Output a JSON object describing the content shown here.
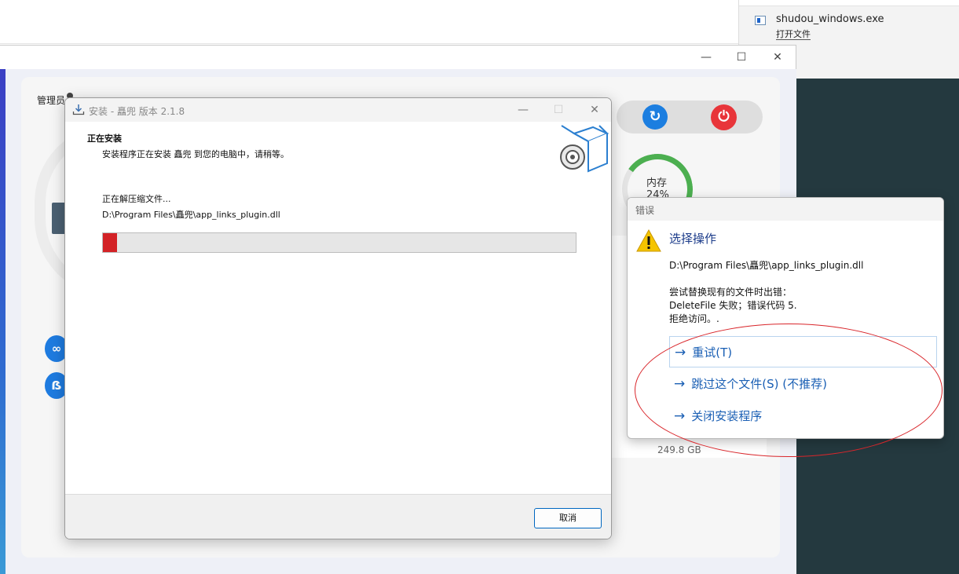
{
  "download": {
    "file_name": "shudou_windows.exe",
    "open_label": "打开文件"
  },
  "app": {
    "admin_label": "管理员",
    "memory_label": "内存",
    "memory_percent": "24%",
    "disk_size": "249.8 GB",
    "refresh_icon": "refresh-icon",
    "power_icon": "power-icon"
  },
  "installer": {
    "title": "安装 - 矗兜 版本 2.1.8",
    "header_title": "正在安装",
    "header_subtitle": "安装程序正在安装 矗兜 到您的电脑中，请稍等。",
    "status": "正在解压缩文件...",
    "current_file": "D:\\Program Files\\矗兜\\app_links_plugin.dll",
    "progress": 0.03,
    "progress_color": "#d32226",
    "cancel_label": "取消"
  },
  "error": {
    "title": "错误",
    "heading": "选择操作",
    "path": "D:\\Program Files\\矗兜\\app_links_plugin.dll",
    "message_lines": [
      "尝试替换现有的文件时出错：",
      "DeleteFile 失败；错误代码 5.",
      "拒绝访问。."
    ],
    "options": [
      "重试(T)",
      "跳过这个文件(S) (不推荐)",
      "关闭安装程序"
    ],
    "selected_option": 0
  },
  "colors": {
    "accent": "#1a5fb4",
    "annotation": "#d9262b",
    "desktop": "#24393f"
  }
}
